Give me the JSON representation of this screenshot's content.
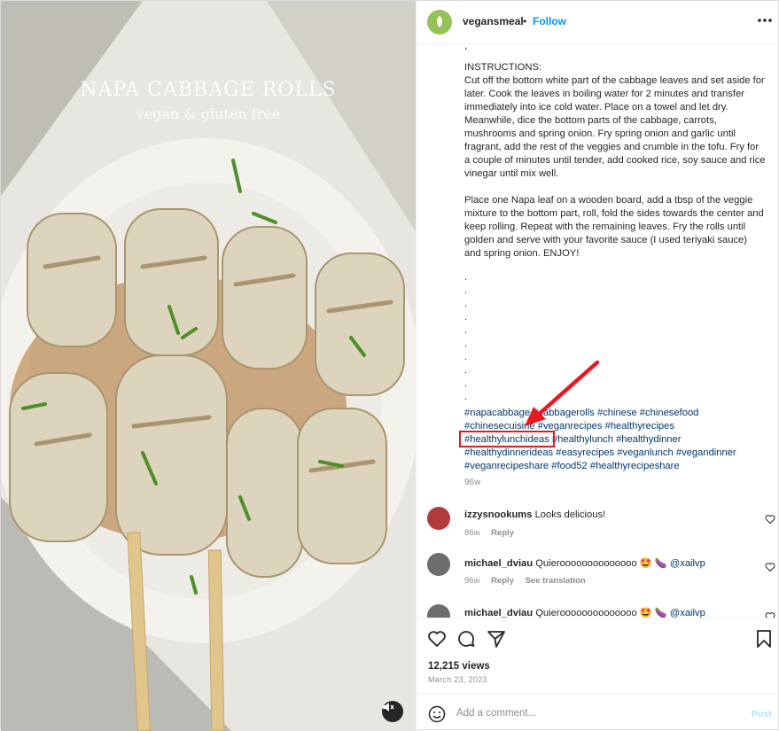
{
  "media": {
    "overlay_title": "NAPA CABBAGE ROLLS",
    "overlay_subtitle": "vegan & gluten free"
  },
  "header": {
    "avatar_text": "vegans meal",
    "username": "vegansmeal",
    "separator": "•",
    "follow_label": "Follow"
  },
  "caption": {
    "cut_line": ",",
    "instructions": "INSTRUCTIONS:\nCut off the bottom white part of the cabbage leaves and set aside for later. Cook the leaves in boiling water for 2 minutes and transfer immediately into ice cold water. Place on a towel and let dry.\nMeanwhile, dice the bottom parts of the cabbage, carrots, mushrooms and spring onion. Fry spring onion and garlic until fragrant, add the rest of the veggies and crumble in the tofu. Fry for a couple of minutes until tender, add cooked rice, soy sauce and rice vinegar until mix well.\n\nPlace one Napa leaf on a wooden board, add a tbsp of the veggie mixture to the bottom part, roll, fold the sides towards the center and keep rolling. Repeat with the remaining leaves. Fry the rolls until golden and serve with your favorite sauce (I used teriyaki sauce) and spring onion. ENJOY!",
    "dots": ".\n.\n.\n.\n.\n.\n.\n.\n.\n.",
    "hashtags": [
      "#napacabbage",
      "#cabbagerolls",
      "#chinese",
      "#chinesefood",
      "#chinesecuisine",
      "#veganrecipes",
      "#healthyrecipes",
      "#healthylunchideas",
      "#healthylunch",
      "#healthydinner",
      "#healthydinnerideas",
      "#easyrecipes",
      "#veganlunch",
      "#vegandinner",
      "#veganrecipeshare",
      "#food52",
      "#healthyrecipeshare"
    ],
    "time": "96w"
  },
  "comments": [
    {
      "user": "izzysnookums",
      "text": "Looks delicious!",
      "time": "86w",
      "reply": "Reply",
      "translate": ""
    },
    {
      "user": "michael_dviau",
      "text": "Quieroooooooooooooo 🤩 🍆",
      "mention": "@xailvp",
      "time": "96w",
      "reply": "Reply",
      "translate": "See translation"
    },
    {
      "user": "michael_dviau",
      "text": "Quieroooooooooooooo 🤩 🍆",
      "mention": "@xailvp",
      "time": "",
      "reply": "",
      "translate": ""
    }
  ],
  "stats": {
    "views": "12,215 views",
    "date": "March 23, 2023"
  },
  "composer": {
    "placeholder": "Add a comment...",
    "post_label": "Post"
  },
  "colors": {
    "link": "#00376b",
    "follow": "#0095f6",
    "highlight": "#e8181f",
    "avatar_bg": "#94c35a"
  }
}
